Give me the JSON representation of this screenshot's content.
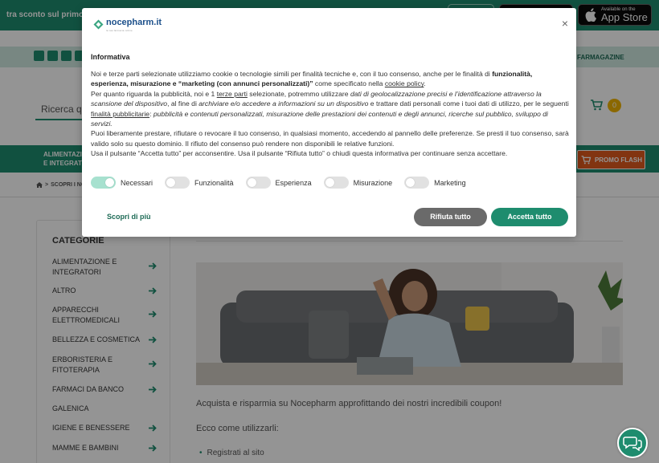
{
  "top_banner": {
    "promo_text": "tra sconto sul primo or",
    "app_store_small": "Available on the",
    "app_store_big": "App Store"
  },
  "nav2": {
    "farmagazine": "FARMAGAZINE"
  },
  "search": {
    "placeholder": "Ricerca qu"
  },
  "cart": {
    "count": "0"
  },
  "catbar": {
    "item1": "ALIMENTAZIO E INTEGRATO",
    "promo_flash": "PROMO FLASH"
  },
  "breadcrumb": {
    "current": "SCOPRI I NOS"
  },
  "sidebar": {
    "title": "CATEGORIE",
    "items": [
      {
        "label": "ALIMENTAZIONE E INTEGRATORI",
        "arrow": true
      },
      {
        "label": "ALTRO",
        "arrow": true
      },
      {
        "label": "APPARECCHI ELETTROMEDICALI",
        "arrow": true
      },
      {
        "label": "BELLEZZA E COSMETICA",
        "arrow": true
      },
      {
        "label": "ERBORISTERIA E FITOTERAPIA",
        "arrow": true
      },
      {
        "label": "FARMACI DA BANCO",
        "arrow": true
      },
      {
        "label": "GALENICA",
        "arrow": false
      },
      {
        "label": "IGIENE E BENESSERE",
        "arrow": true
      },
      {
        "label": "MAMME E BAMBINI",
        "arrow": true
      }
    ]
  },
  "content": {
    "p1": "Acquista e risparmia su Nocepharm approfittando dei nostri incredibili coupon!",
    "p2": "Ecco come utilizzarli:",
    "li1": "Registrati al sito"
  },
  "modal": {
    "logo_text": "nocepharm.it",
    "logo_sub": "la tua farmacia online",
    "close": "×",
    "title": "Informativa",
    "p1_a": "Noi e terze parti selezionate utilizziamo cookie o tecnologie simili per finalità tecniche e, con il tuo consenso, anche per le finalità di ",
    "p1_b": "funzionalità, esperienza, misurazione e “marketing (con annunci personalizzati)”",
    "p1_c": " come specificato nella ",
    "p1_link": "cookie policy",
    "p1_d": ".",
    "p2_a": "Per quanto riguarda la pubblicità, noi e 1 ",
    "p2_link": "terze parti",
    "p2_b": " selezionate, potremmo utilizzare ",
    "p2_i1": "dati di geolocalizzazione precisi e l’identificazione attraverso la scansione del dispositivo",
    "p2_c": ", al fine di ",
    "p2_i2": "archiviare e/o accedere a informazioni su un dispositivo",
    "p2_d": " e trattare dati personali come i tuoi dati di utilizzo, per le seguenti ",
    "p2_link2": "finalità pubblicitarie",
    "p2_e": ": ",
    "p2_i3": "pubblicità e contenuti personalizzati, misurazione delle prestazioni dei contenuti e degli annunci, ricerche sul pubblico, sviluppo di servizi.",
    "p3": "Puoi liberamente prestare, rifiutare o revocare il tuo consenso, in qualsiasi momento, accedendo al pannello delle preferenze. Se presti il tuo consenso, sarà valido solo su questo dominio. Il rifiuto del consenso può rendere non disponibili le relative funzioni.",
    "p4": "Usa il pulsante “Accetta tutto” per acconsentire. Usa il pulsante “Rifiuta tutto” o chiudi questa informativa per continuare senza accettare.",
    "toggles": [
      {
        "label": "Necessari",
        "on": true
      },
      {
        "label": "Funzionalità",
        "on": false
      },
      {
        "label": "Esperienza",
        "on": false
      },
      {
        "label": "Misurazione",
        "on": false
      },
      {
        "label": "Marketing",
        "on": false
      }
    ],
    "learn_more": "Scopri di più",
    "reject_all": "Rifiuta tutto",
    "accept_all": "Accetta tutto"
  },
  "colors": {
    "brand_green": "#1e8c6e",
    "toggle_on": "#a7e1cf",
    "reject_grey": "#6a6a6a",
    "promo_orange": "#e05a1e",
    "cart_badge": "#f0b400"
  }
}
